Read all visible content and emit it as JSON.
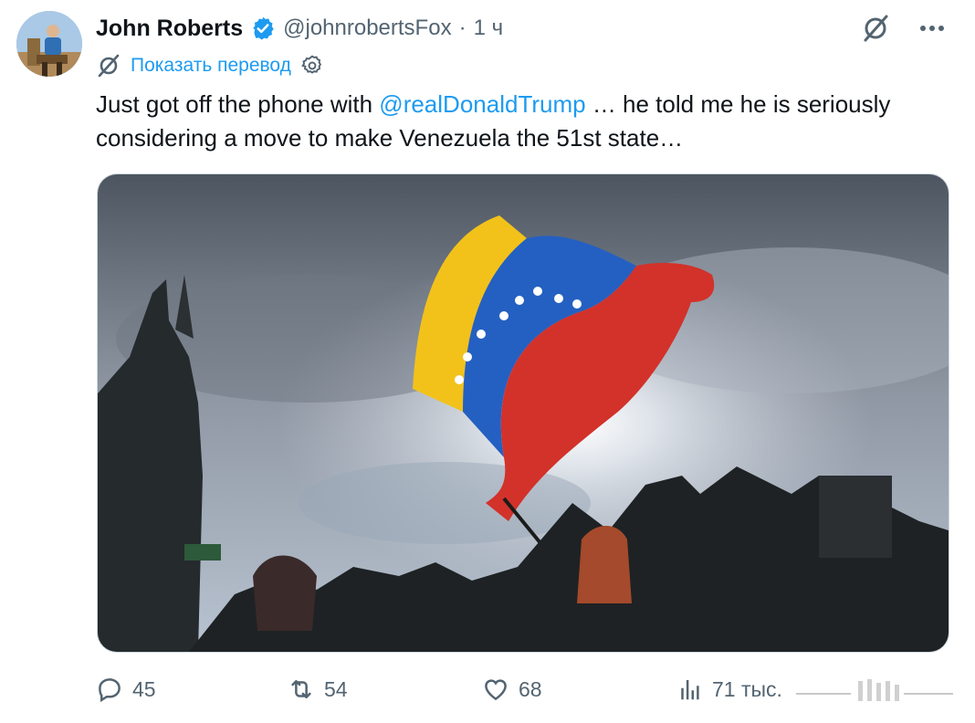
{
  "author": {
    "name": "John Roberts",
    "handle": "@johnrobertsFox",
    "separator": "·",
    "time": "1 ч"
  },
  "translate": {
    "label": "Показать перевод"
  },
  "tweet": {
    "text_before": "Just got off the phone with ",
    "mention": "@realDonaldTrump",
    "text_after": " … he told me he is seriously considering a move to make Venezuela the 51st state…"
  },
  "metrics": {
    "replies": "45",
    "reposts": "54",
    "likes": "68",
    "views": "71 тыс."
  },
  "colors": {
    "accent": "#1d9bf0",
    "secondary_text": "#536471",
    "verified": "#1d9bf0",
    "flag_yellow": "#f2c21b",
    "flag_blue": "#1f57b7",
    "flag_red": "#d2322a"
  },
  "icons": [
    "grok-icon",
    "more-icon",
    "verified-badge-icon",
    "translate-icon",
    "gear-icon",
    "reply-icon",
    "repost-icon",
    "like-icon",
    "views-icon"
  ]
}
